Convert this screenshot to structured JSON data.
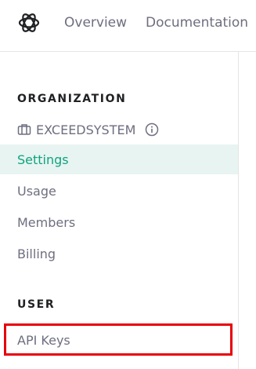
{
  "header": {
    "logo": "openai-logo-icon",
    "links": [
      "Overview",
      "Documentation"
    ]
  },
  "sidebar": {
    "organization_header": "ORGANIZATION",
    "org_name": "EXCEEDSYSTEM",
    "org_icon": "briefcase-icon",
    "org_info_icon": "info-icon",
    "items": [
      {
        "label": "Settings",
        "active": true
      },
      {
        "label": "Usage",
        "active": false
      },
      {
        "label": "Members",
        "active": false
      },
      {
        "label": "Billing",
        "active": false
      }
    ],
    "user_header": "USER",
    "user_items": [
      {
        "label": "API Keys",
        "highlighted": true
      }
    ]
  },
  "colors": {
    "accent": "#10a37f",
    "active_bg": "#e7f4f1",
    "muted_text": "#6e6e80",
    "highlight": "#e8000b"
  }
}
